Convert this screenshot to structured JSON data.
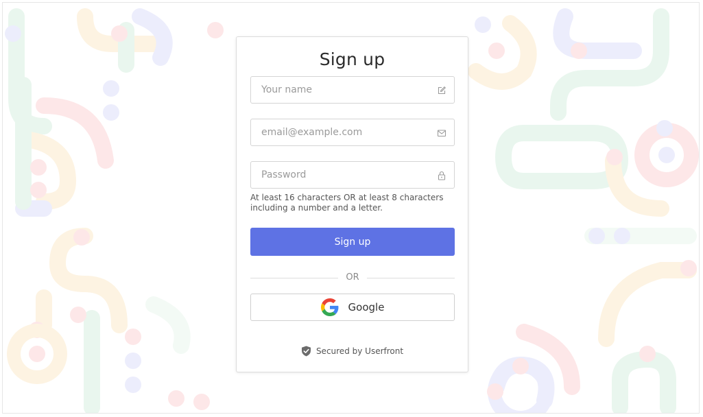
{
  "form": {
    "title": "Sign up",
    "name_placeholder": "Your name",
    "email_placeholder": "email@example.com",
    "password_placeholder": "Password",
    "password_hint": "At least 16 characters OR at least 8 characters including a number and a letter.",
    "submit_label": "Sign up",
    "divider_label": "OR",
    "google_label": "Google",
    "secured_text": "Secured by Userfront"
  },
  "icons": {
    "name_field": "edit-icon",
    "email_field": "envelope-icon",
    "password_field": "lock-icon",
    "google_button": "google-logo-icon",
    "secured": "shield-check-icon"
  },
  "colors": {
    "primary": "#5e72e4",
    "text": "#2b2b2b",
    "border": "#d4d4d4",
    "google_blue": "#4285F4",
    "google_red": "#EA4335",
    "google_yellow": "#FBBC05",
    "google_green": "#34A853"
  }
}
